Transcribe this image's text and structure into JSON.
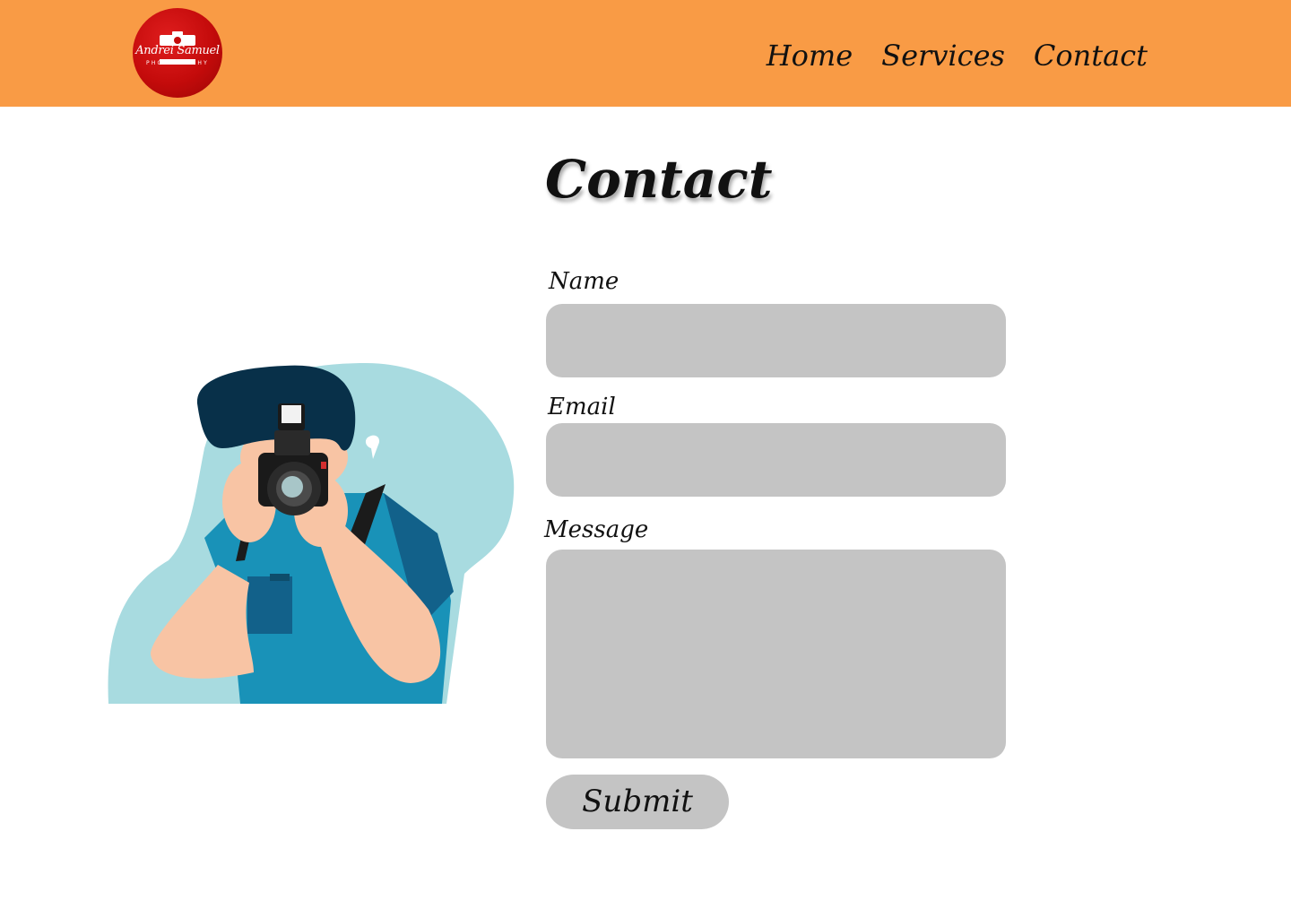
{
  "header": {
    "logo": {
      "name": "Andrei Samuel",
      "tagline": "PHOTOGRAPHY",
      "icon": "camera-icon",
      "color": "#c40b0b"
    },
    "nav": [
      {
        "label": "Home"
      },
      {
        "label": "Services"
      },
      {
        "label": "Contact"
      }
    ],
    "background": "#f99b45"
  },
  "main": {
    "title": "Contact",
    "illustration": "photographer-illustration",
    "form": {
      "name_label": "Name",
      "name_value": "",
      "email_label": "Email",
      "email_value": "",
      "message_label": "Message",
      "message_value": "",
      "submit_label": "Submit",
      "field_color": "#c4c4c4"
    }
  }
}
